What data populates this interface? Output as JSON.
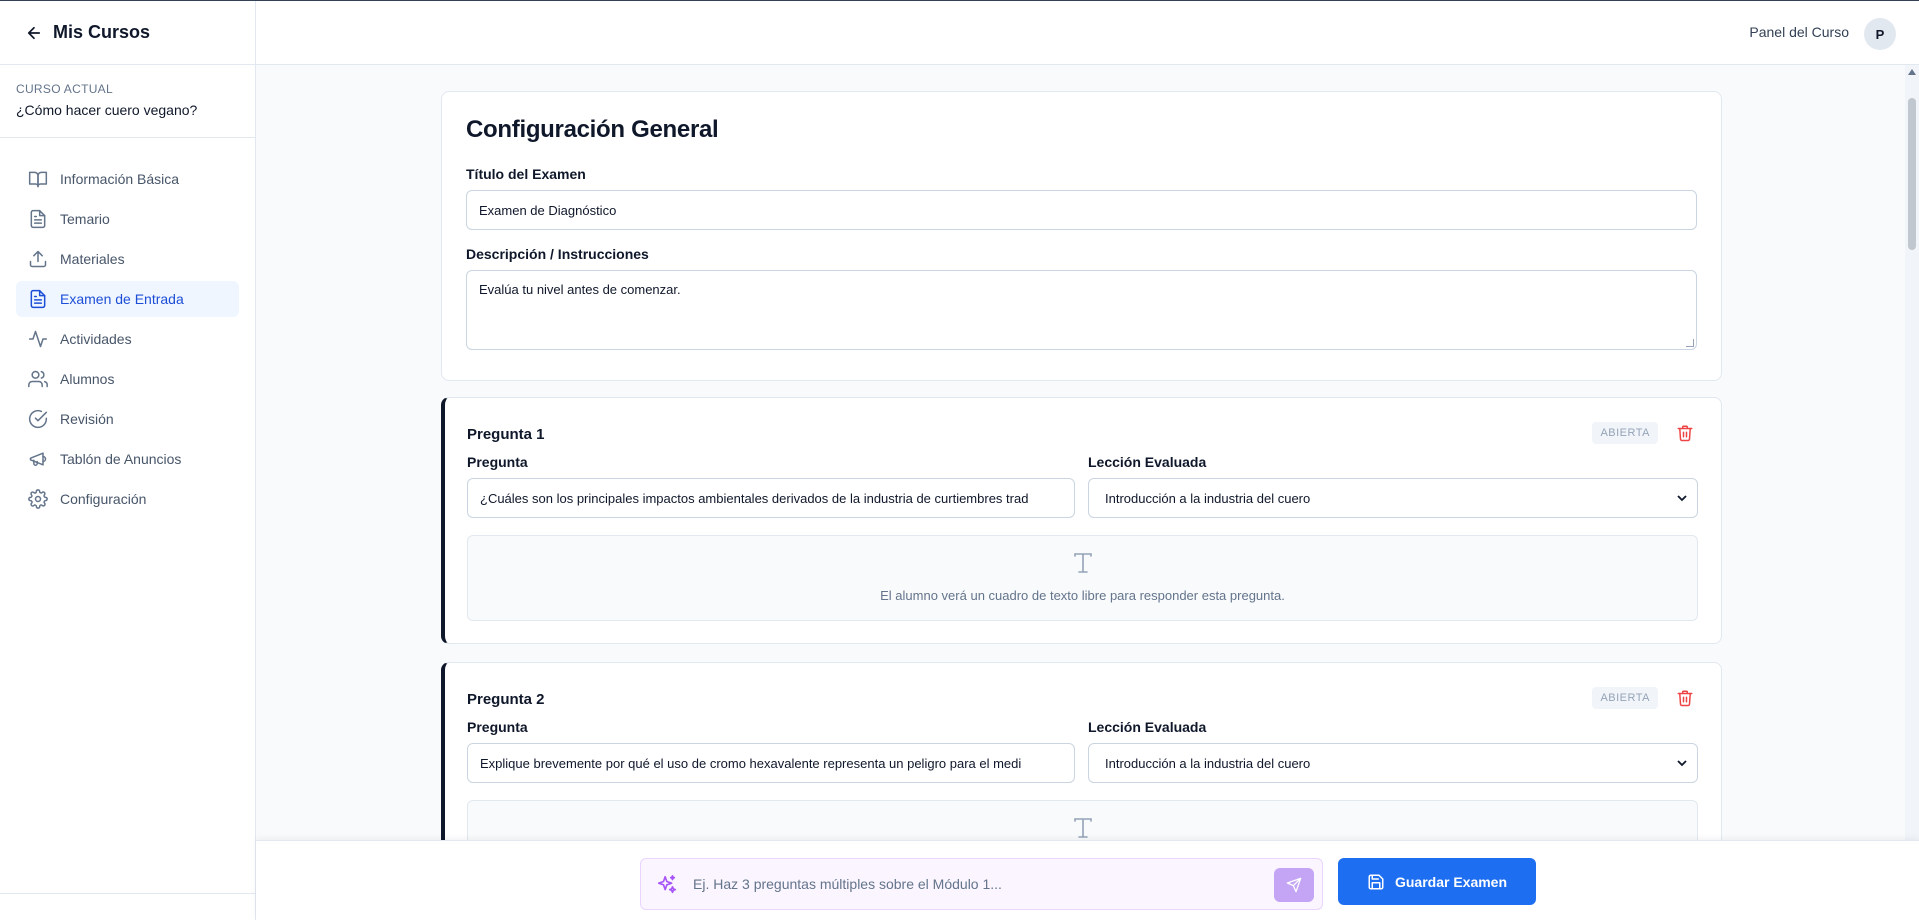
{
  "sidebar": {
    "back_title": "Mis Cursos",
    "course_label": "CURSO ACTUAL",
    "course_name": "¿Cómo hacer cuero vegano?",
    "items": [
      {
        "label": "Información Básica",
        "icon": "book-open-icon"
      },
      {
        "label": "Temario",
        "icon": "file-text-icon"
      },
      {
        "label": "Materiales",
        "icon": "upload-icon"
      },
      {
        "label": "Examen de Entrada",
        "icon": "file-text-icon",
        "active": true
      },
      {
        "label": "Actividades",
        "icon": "activity-icon"
      },
      {
        "label": "Alumnos",
        "icon": "users-icon"
      },
      {
        "label": "Revisión",
        "icon": "check-circle-icon"
      },
      {
        "label": "Tablón de Anuncios",
        "icon": "megaphone-icon"
      },
      {
        "label": "Configuración",
        "icon": "gear-icon"
      }
    ]
  },
  "header": {
    "panel_label": "Panel del Curso",
    "avatar_initial": "P"
  },
  "config": {
    "title": "Configuración General",
    "exam_title_label": "Título del Examen",
    "exam_title_value": "Examen de Diagnóstico",
    "description_label": "Descripción / Instrucciones",
    "description_value": "Evalúa tu nivel antes de comenzar."
  },
  "questions": [
    {
      "title": "Pregunta 1",
      "type_badge": "ABIERTA",
      "question_label": "Pregunta",
      "question_value": "¿Cuáles son los principales impactos ambientales derivados de la industria de curtiembres trad",
      "lesson_label": "Lección Evaluada",
      "lesson_value": "Introducción a la industria del cuero",
      "open_hint": "El alumno verá un cuadro de texto libre para responder esta pregunta."
    },
    {
      "title": "Pregunta 2",
      "type_badge": "ABIERTA",
      "question_label": "Pregunta",
      "question_value": "Explique brevemente por qué el uso de cromo hexavalente representa un peligro para el medi",
      "lesson_label": "Lección Evaluada",
      "lesson_value": "Introducción a la industria del cuero"
    }
  ],
  "bottom": {
    "ai_placeholder": "Ej. Haz 3 preguntas múltiples sobre el Módulo 1...",
    "save_label": "Guardar Examen"
  },
  "colors": {
    "accent": "#1d6ef0",
    "active_nav_bg": "#eff6ff",
    "danger": "#ef4444",
    "ai_purple": "#a855f7"
  }
}
